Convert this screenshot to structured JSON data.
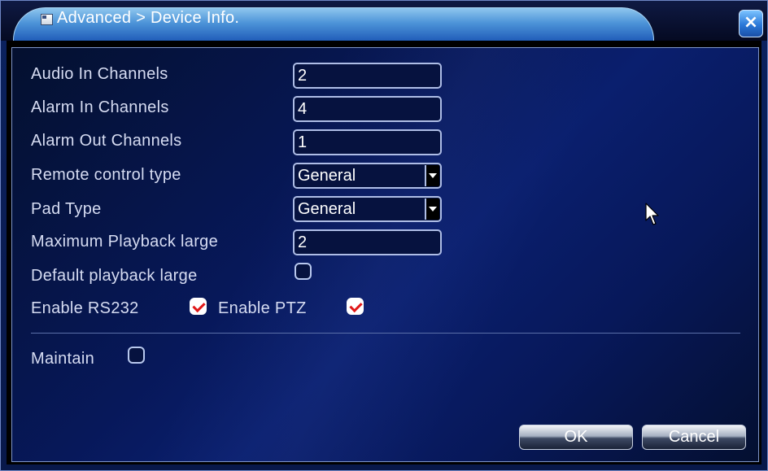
{
  "window": {
    "title": "Advanced > Device Info.",
    "close_glyph": "×",
    "title_icon": "folder-icon"
  },
  "settings": {
    "audio_in_channels": {
      "label": "Audio In Channels",
      "value": "2"
    },
    "alarm_in_channels": {
      "label": "Alarm In Channels",
      "value": "4"
    },
    "alarm_out_channels": {
      "label": "Alarm Out Channels",
      "value": "1"
    },
    "remote_control_type": {
      "label": "Remote control type",
      "value": "General"
    },
    "pad_type": {
      "label": "Pad Type",
      "value": "General"
    },
    "maximum_playback_large": {
      "label": "Maximum Playback large",
      "value": "2"
    },
    "default_playback_large": {
      "label": "Default playback large",
      "checked": false
    },
    "enable_rs232": {
      "label": "Enable RS232",
      "checked": true
    },
    "enable_ptz": {
      "label": "Enable PTZ",
      "checked": true
    },
    "maintain": {
      "label": "Maintain",
      "checked": false
    }
  },
  "buttons": {
    "ok": "OK",
    "cancel": "Cancel"
  },
  "colors": {
    "panel_background": "#07185a",
    "title_tab": "#4c93d8",
    "text": "#d6dcf2",
    "field_border": "#aebde6",
    "check_mark": "#e01818"
  }
}
